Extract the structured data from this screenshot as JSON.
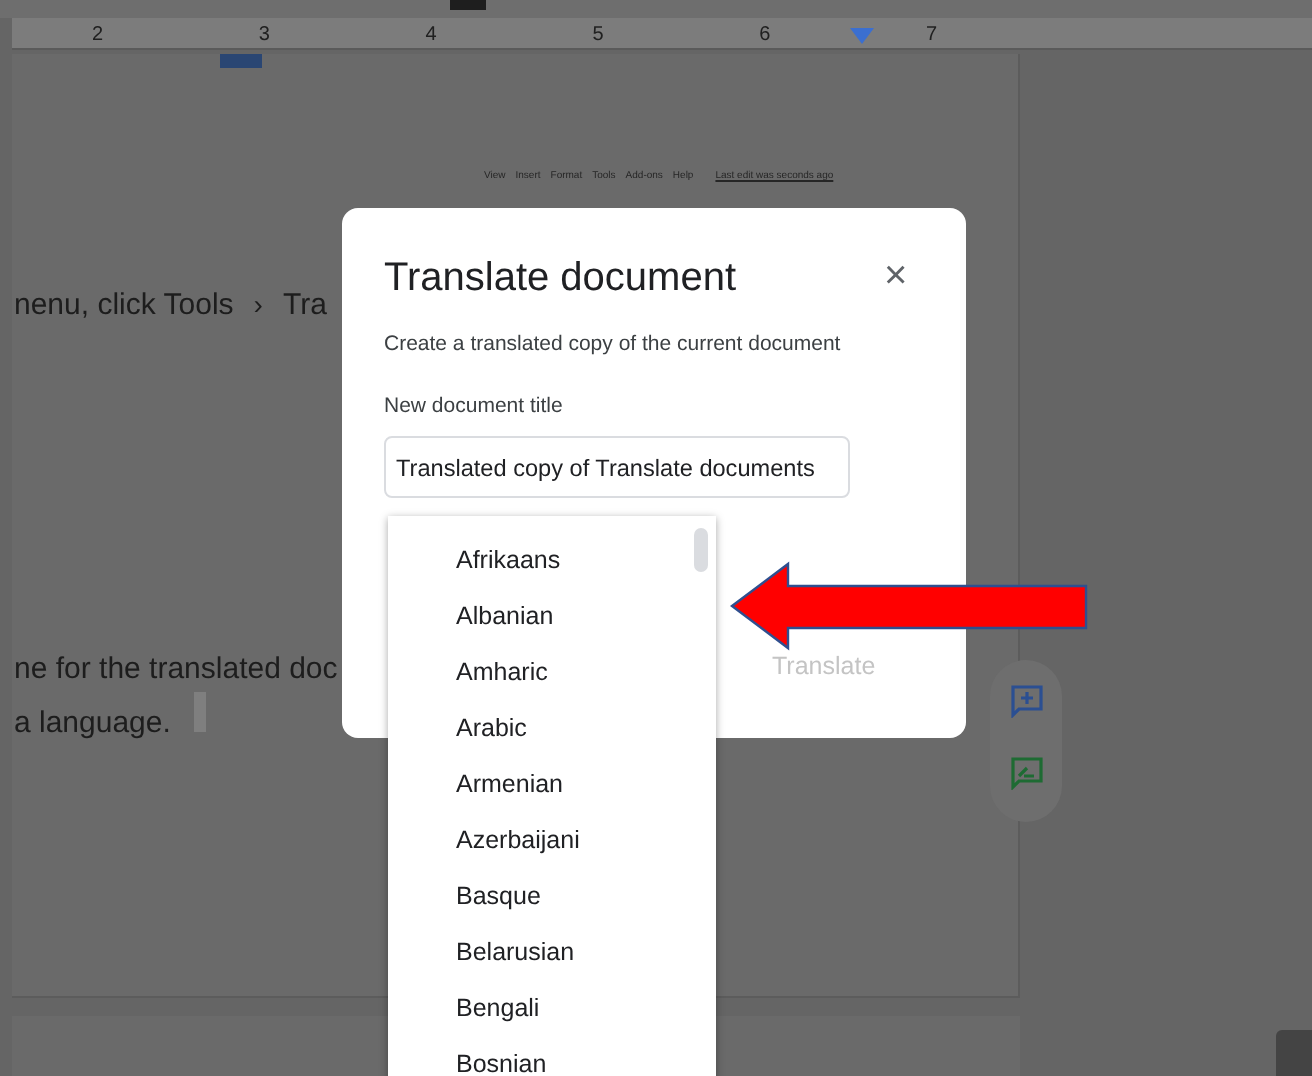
{
  "ruler": {
    "numbers": [
      "2",
      "3",
      "4",
      "5",
      "6",
      "7"
    ]
  },
  "document": {
    "menu": [
      "View",
      "Insert",
      "Format",
      "Tools",
      "Add-ons",
      "Help"
    ],
    "last_edit": "Last edit was seconds ago",
    "step": {
      "text": "nenu, click Tools",
      "separator": "›",
      "next": "Tra"
    },
    "paragraph": [
      "ne for the translated doc",
      "a language."
    ]
  },
  "dialog": {
    "title": "Translate document",
    "close": "×",
    "subtitle": "Create a translated copy of the current document",
    "field_label": "New document title",
    "field_value": "Translated copy of Translate documents",
    "translate_button": {
      "label": "Translate",
      "disabled": true
    }
  },
  "language_list": {
    "items": [
      {
        "label": "Afrikaans"
      },
      {
        "label": "Albanian"
      },
      {
        "label": "Amharic"
      },
      {
        "label": "Arabic"
      },
      {
        "label": "Armenian"
      },
      {
        "label": "Azerbaijani"
      },
      {
        "label": "Basque"
      },
      {
        "label": "Belarusian"
      },
      {
        "label": "Bengali"
      },
      {
        "label": "Bosnian"
      }
    ]
  }
}
